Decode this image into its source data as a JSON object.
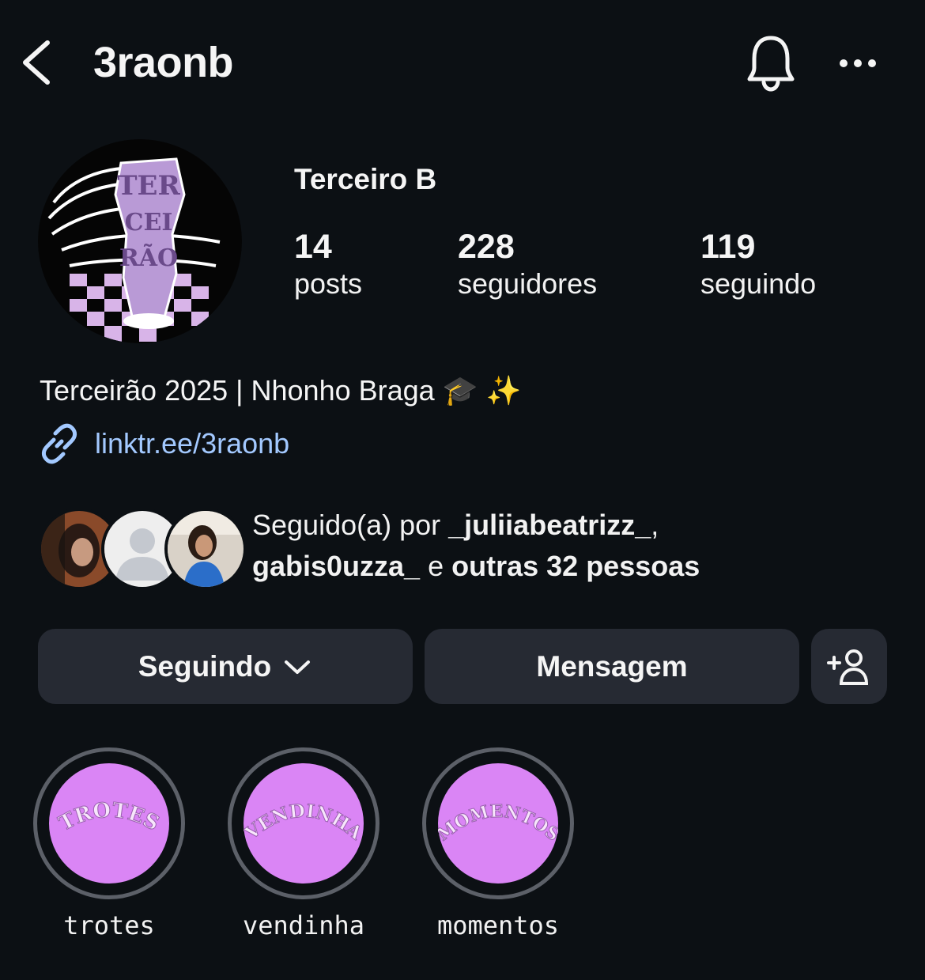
{
  "header": {
    "username": "3raonb"
  },
  "profile": {
    "display_name": "Terceiro B",
    "stats": [
      {
        "value": "14",
        "label": "posts"
      },
      {
        "value": "228",
        "label": "seguidores"
      },
      {
        "value": "119",
        "label": "seguindo"
      }
    ],
    "bio": "Terceirão 2025 | Nhonho Braga 🎓 ✨",
    "link": "linktr.ee/3raonb",
    "avatar_logo_text": "TERCEIRÃO"
  },
  "followed_by": {
    "prefix": "Seguido(a) por ",
    "user1": "_juliiabeatrizz_",
    "sep": ",",
    "user2": "gabis0uzza_",
    "conj": " e ",
    "others": "outras 32 pessoas"
  },
  "actions": {
    "following_label": "Seguindo",
    "message_label": "Mensagem"
  },
  "highlights": [
    {
      "cover_text": "TROTES",
      "caption": "trotes"
    },
    {
      "cover_text": "VENDINHA",
      "caption": "vendinha"
    },
    {
      "cover_text": "MOMENTOS",
      "caption": "momentos"
    }
  ],
  "colors": {
    "background": "#0c1014",
    "button": "#262a33",
    "link": "#a3c9ff",
    "highlight_fill": "#da85f5",
    "highlight_ring": "#5c6068"
  }
}
